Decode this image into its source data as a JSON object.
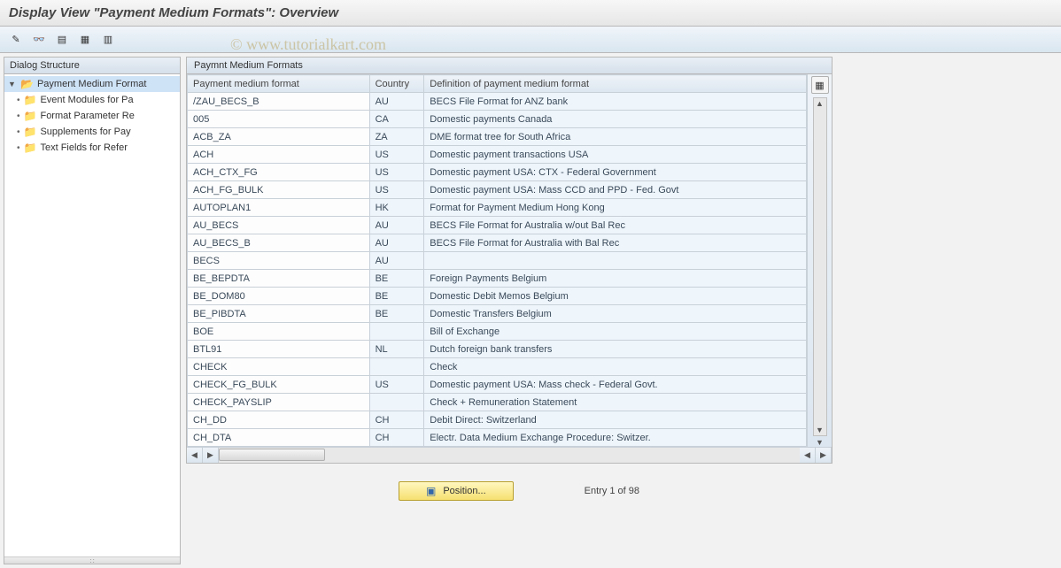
{
  "title": "Display View \"Payment Medium Formats\": Overview",
  "watermark": "© www.tutorialkart.com",
  "toolbar": {
    "icons": [
      "tool-change",
      "tool-glasses",
      "tool-select-all",
      "tool-export",
      "tool-table"
    ]
  },
  "sidebar": {
    "header": "Dialog Structure",
    "root": {
      "label": "Payment Medium Format",
      "open": true,
      "selected": true
    },
    "children": [
      {
        "label": "Event Modules for Pa"
      },
      {
        "label": "Format Parameter Re"
      },
      {
        "label": "Supplements for Pay"
      },
      {
        "label": "Text Fields for Refer"
      }
    ]
  },
  "grid": {
    "title": "Paymnt Medium Formats",
    "columns": {
      "format": "Payment medium format",
      "country": "Country",
      "definition": "Definition of payment medium format"
    },
    "rows": [
      {
        "format": "/ZAU_BECS_B",
        "country": "AU",
        "definition": "BECS File Format for ANZ bank"
      },
      {
        "format": "005",
        "country": "CA",
        "definition": "Domestic payments Canada"
      },
      {
        "format": "ACB_ZA",
        "country": "ZA",
        "definition": "DME format tree for South Africa"
      },
      {
        "format": "ACH",
        "country": "US",
        "definition": "Domestic payment transactions USA"
      },
      {
        "format": "ACH_CTX_FG",
        "country": "US",
        "definition": "Domestic payment USA: CTX - Federal Government"
      },
      {
        "format": "ACH_FG_BULK",
        "country": "US",
        "definition": "Domestic payment USA: Mass CCD and PPD - Fed. Govt"
      },
      {
        "format": "AUTOPLAN1",
        "country": "HK",
        "definition": "Format for Payment Medium Hong Kong"
      },
      {
        "format": "AU_BECS",
        "country": "AU",
        "definition": "BECS File Format for Australia w/out Bal Rec"
      },
      {
        "format": "AU_BECS_B",
        "country": "AU",
        "definition": "BECS File Format for Australia with Bal Rec"
      },
      {
        "format": "BECS",
        "country": "AU",
        "definition": ""
      },
      {
        "format": "BE_BEPDTA",
        "country": "BE",
        "definition": "Foreign Payments Belgium"
      },
      {
        "format": "BE_DOM80",
        "country": "BE",
        "definition": "Domestic Debit Memos Belgium"
      },
      {
        "format": "BE_PIBDTA",
        "country": "BE",
        "definition": "Domestic Transfers Belgium"
      },
      {
        "format": "BOE",
        "country": "",
        "definition": "Bill of Exchange"
      },
      {
        "format": "BTL91",
        "country": "NL",
        "definition": "Dutch foreign bank transfers"
      },
      {
        "format": "CHECK",
        "country": "",
        "definition": "Check"
      },
      {
        "format": "CHECK_FG_BULK",
        "country": "US",
        "definition": "Domestic payment USA: Mass check - Federal Govt."
      },
      {
        "format": "CHECK_PAYSLIP",
        "country": "",
        "definition": "Check + Remuneration Statement"
      },
      {
        "format": "CH_DD",
        "country": "CH",
        "definition": "Debit Direct: Switzerland"
      },
      {
        "format": "CH_DTA",
        "country": "CH",
        "definition": "Electr. Data Medium Exchange Procedure: Switzer."
      }
    ]
  },
  "footer": {
    "position_label": "Position...",
    "entry_info": "Entry 1 of 98"
  }
}
